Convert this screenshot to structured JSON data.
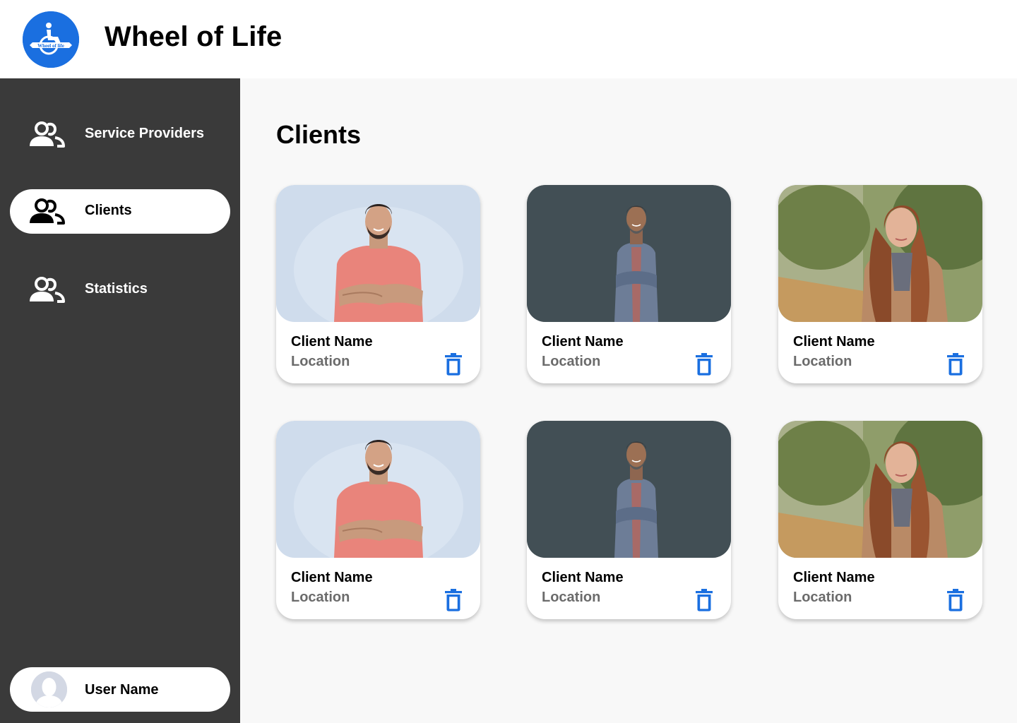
{
  "app": {
    "title": "Wheel of Life",
    "logo_text": "Wheel of life"
  },
  "sidebar": {
    "items": [
      {
        "label": "Service Providers",
        "icon": "people-icon",
        "active": false
      },
      {
        "label": "Clients",
        "icon": "people-icon",
        "active": true
      },
      {
        "label": "Statistics",
        "icon": "people-icon",
        "active": false
      }
    ],
    "user": {
      "name": "User Name",
      "icon": "avatar-placeholder-icon"
    }
  },
  "main": {
    "title": "Clients",
    "cards": [
      {
        "name": "Client Name",
        "location": "Location",
        "photo": "man-pink-tshirt",
        "delete_icon": "trash-icon"
      },
      {
        "name": "Client Name",
        "location": "Location",
        "photo": "man-denim-jacket",
        "delete_icon": "trash-icon"
      },
      {
        "name": "Client Name",
        "location": "Location",
        "photo": "woman-outdoor",
        "delete_icon": "trash-icon"
      },
      {
        "name": "Client Name",
        "location": "Location",
        "photo": "man-pink-tshirt",
        "delete_icon": "trash-icon"
      },
      {
        "name": "Client Name",
        "location": "Location",
        "photo": "man-denim-jacket",
        "delete_icon": "trash-icon"
      },
      {
        "name": "Client Name",
        "location": "Location",
        "photo": "woman-outdoor",
        "delete_icon": "trash-icon"
      }
    ]
  },
  "colors": {
    "accent": "#1a6fe0",
    "sidebar_bg": "#3a3a3a",
    "content_bg": "#f8f8f8",
    "location_text": "#6b6b6b"
  }
}
